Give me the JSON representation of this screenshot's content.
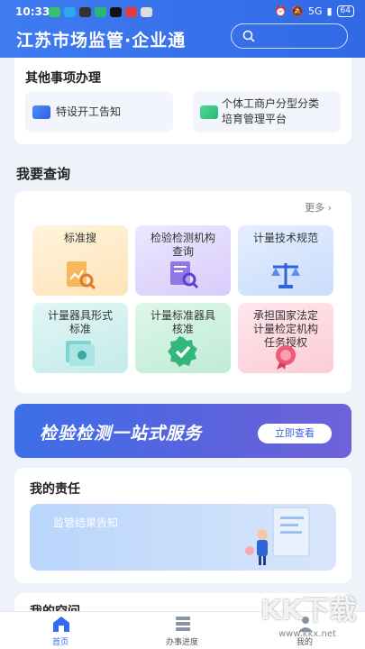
{
  "status_bar": {
    "time": "10:33",
    "battery": "64",
    "signal": "5G"
  },
  "header": {
    "title": "江苏市场监管·企业通"
  },
  "other_matters": {
    "title": "其他事项办理",
    "items": [
      {
        "label": "特设开工告知"
      },
      {
        "label_line1": "个体工商户分型分类",
        "label_line2": "培育管理平台"
      }
    ]
  },
  "query": {
    "title": "我要查询",
    "more": "更多",
    "tiles": [
      {
        "line1": "标准搜",
        "line2": "",
        "line3": ""
      },
      {
        "line1": "检验检测机构",
        "line2": "查询",
        "line3": ""
      },
      {
        "line1": "计量技术规范",
        "line2": "",
        "line3": ""
      },
      {
        "line1": "计量器具形式",
        "line2": "标准",
        "line3": ""
      },
      {
        "line1": "计量标准器具",
        "line2": "核准",
        "line3": ""
      },
      {
        "line1": "承担国家法定",
        "line2": "计量检定机构",
        "line3": "任务授权"
      }
    ]
  },
  "banner": {
    "text": "检验检测一站式服务",
    "button": "立即查看"
  },
  "responsibility": {
    "title": "我的责任",
    "card_label": "监管结果告知"
  },
  "next_section": {
    "title": "我的空间"
  },
  "tabbar": {
    "items": [
      {
        "label": "首页"
      },
      {
        "label": "办事进度"
      },
      {
        "label": "我的"
      }
    ]
  },
  "watermark": {
    "line1": "KK下载",
    "line2": "www.kkx.net"
  },
  "colors": {
    "brand": "#3a70ec",
    "active_tab": "#2f6bf0"
  }
}
